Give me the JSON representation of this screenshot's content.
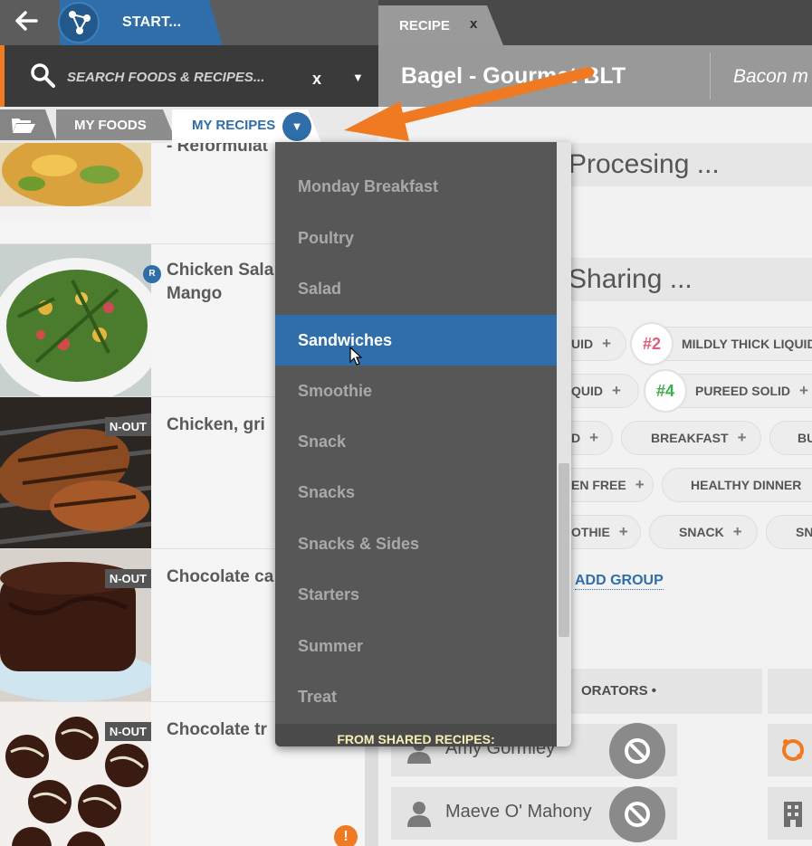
{
  "topbar": {
    "back_icon": "arrow-left-icon",
    "start_label": "START...",
    "recipe_tab_label": "RECIPE",
    "recipe_tab_close": "x"
  },
  "search": {
    "placeholder": "SEARCH FOODS & RECIPES...",
    "clear_label": "x",
    "caret": "▼"
  },
  "recipe": {
    "title": "Bagel - Gourmet BLT",
    "subtitle": "Bacon m"
  },
  "library_tabs": {
    "folder_icon": "folder-open-icon",
    "my_foods": "MY FOODS",
    "my_recipes": "MY RECIPES",
    "dropdown_caret": "▼"
  },
  "recipe_list": [
    {
      "title": "- Reformulat",
      "badge": "",
      "top_offset": 0
    },
    {
      "title": "Chicken Sala\nMango",
      "badge": "",
      "r_badge": "R"
    },
    {
      "title": "Chicken, gri",
      "badge": "N-OUT"
    },
    {
      "title": "Chocolate ca",
      "badge": "N-OUT"
    },
    {
      "title": "Chocolate tr",
      "badge": "N-OUT"
    }
  ],
  "warning_badge": "!",
  "sections": {
    "processing": "Procesing ...",
    "sharing": "Sharing ..."
  },
  "tags": {
    "row1": [
      "UID",
      "MILDLY THICK LIQUID"
    ],
    "row1_num": "#2",
    "row2": [
      "QUID",
      "PUREED SOLID"
    ],
    "row2_num": "#4",
    "row3": [
      "D",
      "BREAKFAST",
      "BU"
    ],
    "row4": [
      "EN FREE",
      "HEALTHY DINNER"
    ],
    "row5": [
      "OTHIE",
      "SNACK",
      "SN"
    ]
  },
  "add_group": "ADD GROUP",
  "collaborators": {
    "header": "ORATORS •",
    "people": [
      "Amy Gormley",
      "Maeve O' Mahony"
    ]
  },
  "dropdown": {
    "items": [
      "Monday Breakfast",
      "Poultry",
      "Salad",
      "Sandwiches",
      "Smoothie",
      "Snack",
      "Snacks",
      "Snacks & Sides",
      "Starters",
      "Summer",
      "Treat"
    ],
    "selected": "Sandwiches",
    "footer": "FROM SHARED RECIPES:"
  },
  "colors": {
    "accent_blue": "#2f6ea8",
    "accent_orange": "#f07a22",
    "dropdown_bg": "#575757",
    "tag_num_2": "#e25b7a",
    "tag_num_4": "#3fae4a"
  }
}
